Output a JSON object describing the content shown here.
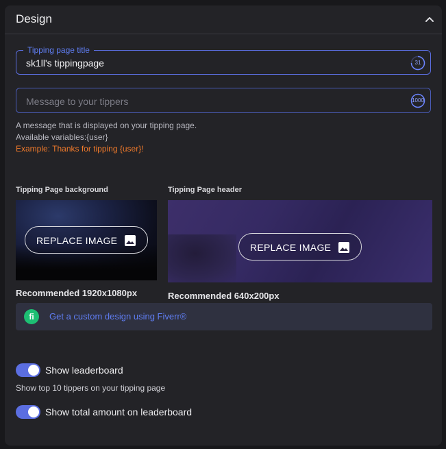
{
  "section": {
    "title": "Design",
    "collapse_icon": "chevron-up-icon"
  },
  "title_field": {
    "legend": "Tipping page title",
    "value": "sk1ll's tippingpage",
    "counter": "31"
  },
  "message_field": {
    "placeholder": "Message to your tippers",
    "counter": "1000",
    "help_line1": "A message that is displayed on your tipping page.",
    "help_line2": "Available variables:{user}",
    "example": "Example: Thanks for tipping {user}!"
  },
  "background_image": {
    "label": "Tipping Page background",
    "button": "REPLACE IMAGE",
    "icon": "image-icon",
    "recommended": "Recommended 1920x1080px"
  },
  "header_image": {
    "label": "Tipping Page header",
    "button": "REPLACE IMAGE",
    "icon": "image-icon",
    "recommended": "Recommended 640x200px"
  },
  "fiverr": {
    "badge": "fi",
    "link": "Get a custom design using Fiverr®",
    "badge_color": "#1dbf73"
  },
  "leaderboard": {
    "show_label": "Show leaderboard",
    "show_on": true,
    "help": "Show top 10 tippers on your tipping page",
    "total_label": "Show total amount on leaderboard",
    "total_on": true
  },
  "colors": {
    "accent": "#5b6ee1",
    "warning": "#f07a2b",
    "panel": "#232327"
  }
}
